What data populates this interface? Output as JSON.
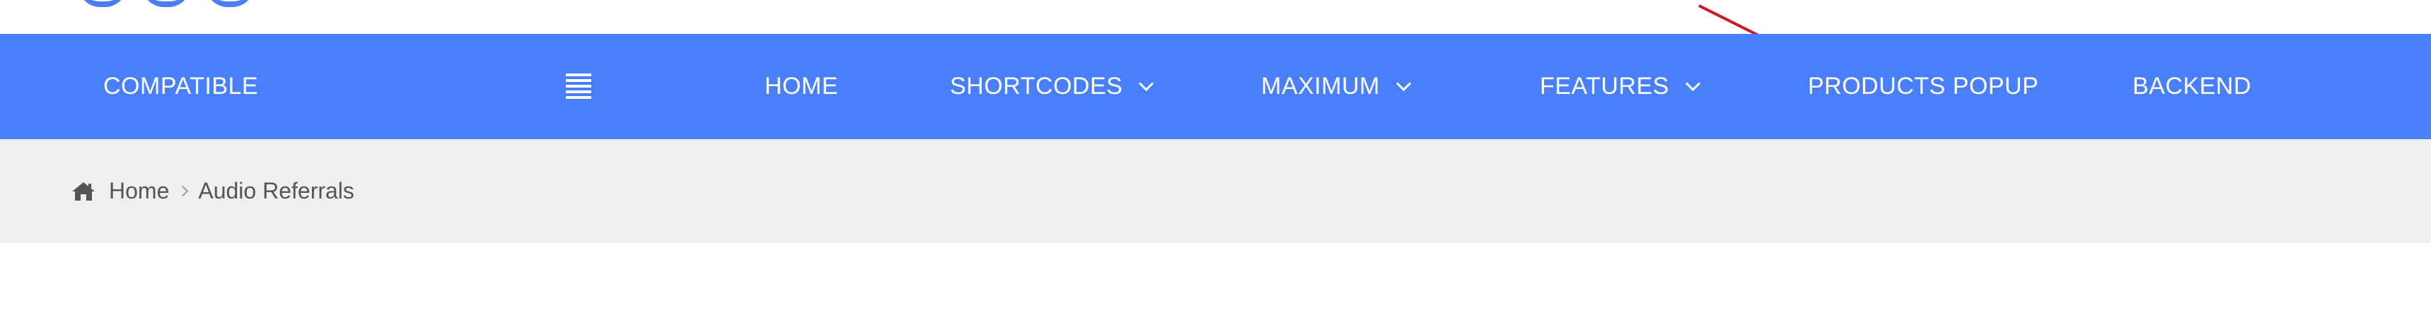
{
  "nav": {
    "compatible_label": "COMPATIBLE",
    "hamburger_icon": "menu-icon",
    "items": [
      {
        "label": "HOME",
        "dropdown": false
      },
      {
        "label": "SHORTCODES",
        "dropdown": true
      },
      {
        "label": "MAXIMUM",
        "dropdown": true
      },
      {
        "label": "FEATURES",
        "dropdown": true
      },
      {
        "label": "PRODUCTS POPUP",
        "dropdown": false
      },
      {
        "label": "BACKEND",
        "dropdown": false
      }
    ]
  },
  "breadcrumb": {
    "home_icon": "home-icon",
    "home_label": "Home",
    "current_label": "Audio Referrals"
  },
  "colors": {
    "nav_background": "#4a7ffc",
    "breadcrumb_background": "#efefef",
    "annotation_arrow": "#d0142b",
    "text_light": "#ffffff",
    "text_dark": "#555555"
  }
}
